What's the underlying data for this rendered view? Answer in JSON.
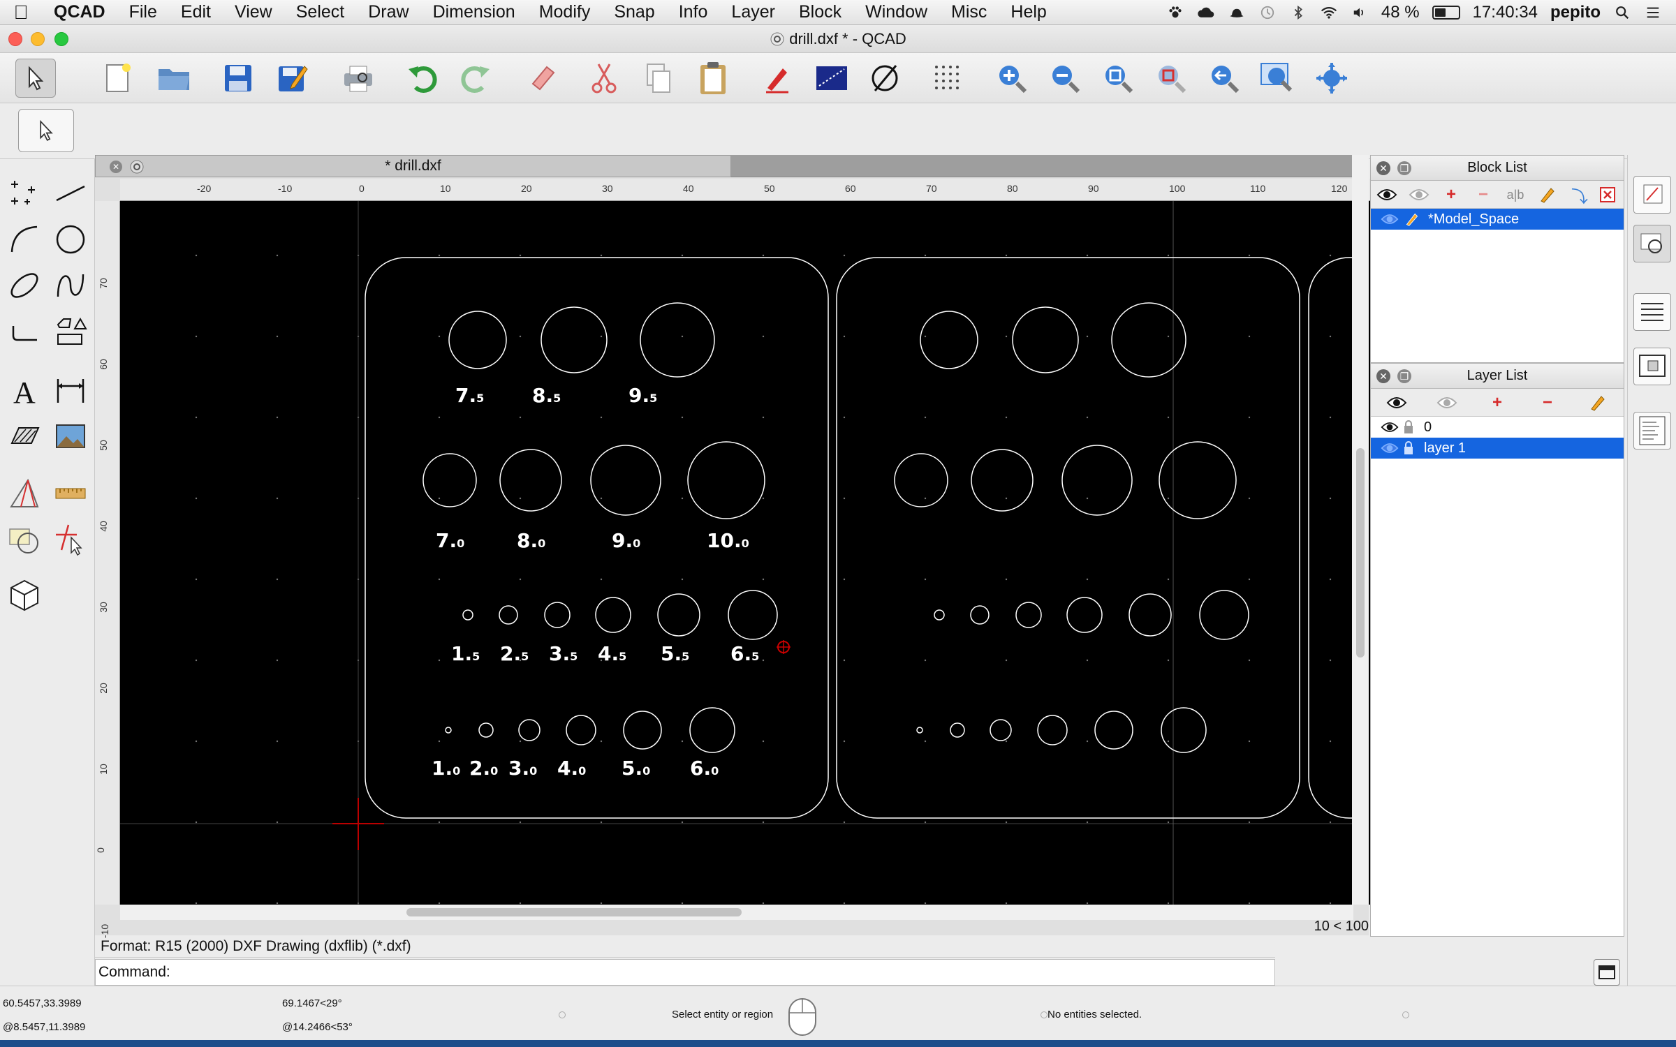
{
  "menubar": {
    "app_name": "QCAD",
    "items": [
      "File",
      "Edit",
      "View",
      "Select",
      "Draw",
      "Dimension",
      "Modify",
      "Snap",
      "Info",
      "Layer",
      "Block",
      "Window",
      "Misc",
      "Help"
    ],
    "battery": "48 %",
    "battery_level": 0.48,
    "clock": "17:40:34",
    "user": "pepito"
  },
  "window": {
    "title": "drill.dxf * - QCAD"
  },
  "document": {
    "tab_label": "* drill.dxf",
    "grid_readout": "10 < 100"
  },
  "rulers": {
    "top": [
      "-20",
      "-10",
      "0",
      "10",
      "20",
      "30",
      "40",
      "50",
      "60",
      "70",
      "80",
      "90",
      "100",
      "110",
      "120"
    ],
    "left": [
      "70",
      "60",
      "50",
      "40",
      "30",
      "20",
      "10",
      "0",
      "-10"
    ]
  },
  "drawing": {
    "labels_row1": [
      {
        "main": "7.",
        "sub": "5"
      },
      {
        "main": "8.",
        "sub": "5"
      },
      {
        "main": "9.",
        "sub": "5"
      }
    ],
    "labels_row2": [
      {
        "main": "7.",
        "sub": "0"
      },
      {
        "main": "8.",
        "sub": "0"
      },
      {
        "main": "9.",
        "sub": "0"
      },
      {
        "main": "10.",
        "sub": "0"
      }
    ],
    "labels_row3": [
      {
        "main": "1.",
        "sub": "5"
      },
      {
        "main": "2.",
        "sub": "5"
      },
      {
        "main": "3.",
        "sub": "5"
      },
      {
        "main": "4.",
        "sub": "5"
      },
      {
        "main": "5.",
        "sub": "5"
      },
      {
        "main": "6.",
        "sub": "5"
      }
    ],
    "labels_row4": [
      {
        "main": "1.",
        "sub": "0"
      },
      {
        "main": "2.",
        "sub": "0"
      },
      {
        "main": "3.",
        "sub": "0"
      },
      {
        "main": "4.",
        "sub": "0"
      },
      {
        "main": "5.",
        "sub": "0"
      },
      {
        "main": "6.",
        "sub": "0"
      }
    ]
  },
  "block_list": {
    "title": "Block List",
    "blocks": [
      {
        "name": "*Model_Space",
        "selected": true
      }
    ]
  },
  "layer_list": {
    "title": "Layer List",
    "layers": [
      {
        "name": "0",
        "selected": false
      },
      {
        "name": "layer 1",
        "selected": true
      }
    ]
  },
  "console": {
    "format_text": "Format: R15 (2000) DXF Drawing (dxflib) (*.dxf)",
    "command_label": "Command:",
    "command_value": ""
  },
  "status": {
    "abs_coord": "60.5457,33.3989",
    "rel_coord": "@8.5457,11.3989",
    "polar_coord": "69.1467<29°",
    "rel_polar": "@14.2466<53°",
    "prompt": "Select entity or region",
    "selection": "No entities selected."
  },
  "colors": {
    "selection": "#1565e0",
    "canvas": "#000000",
    "drawing_lines": "#ffffff"
  }
}
